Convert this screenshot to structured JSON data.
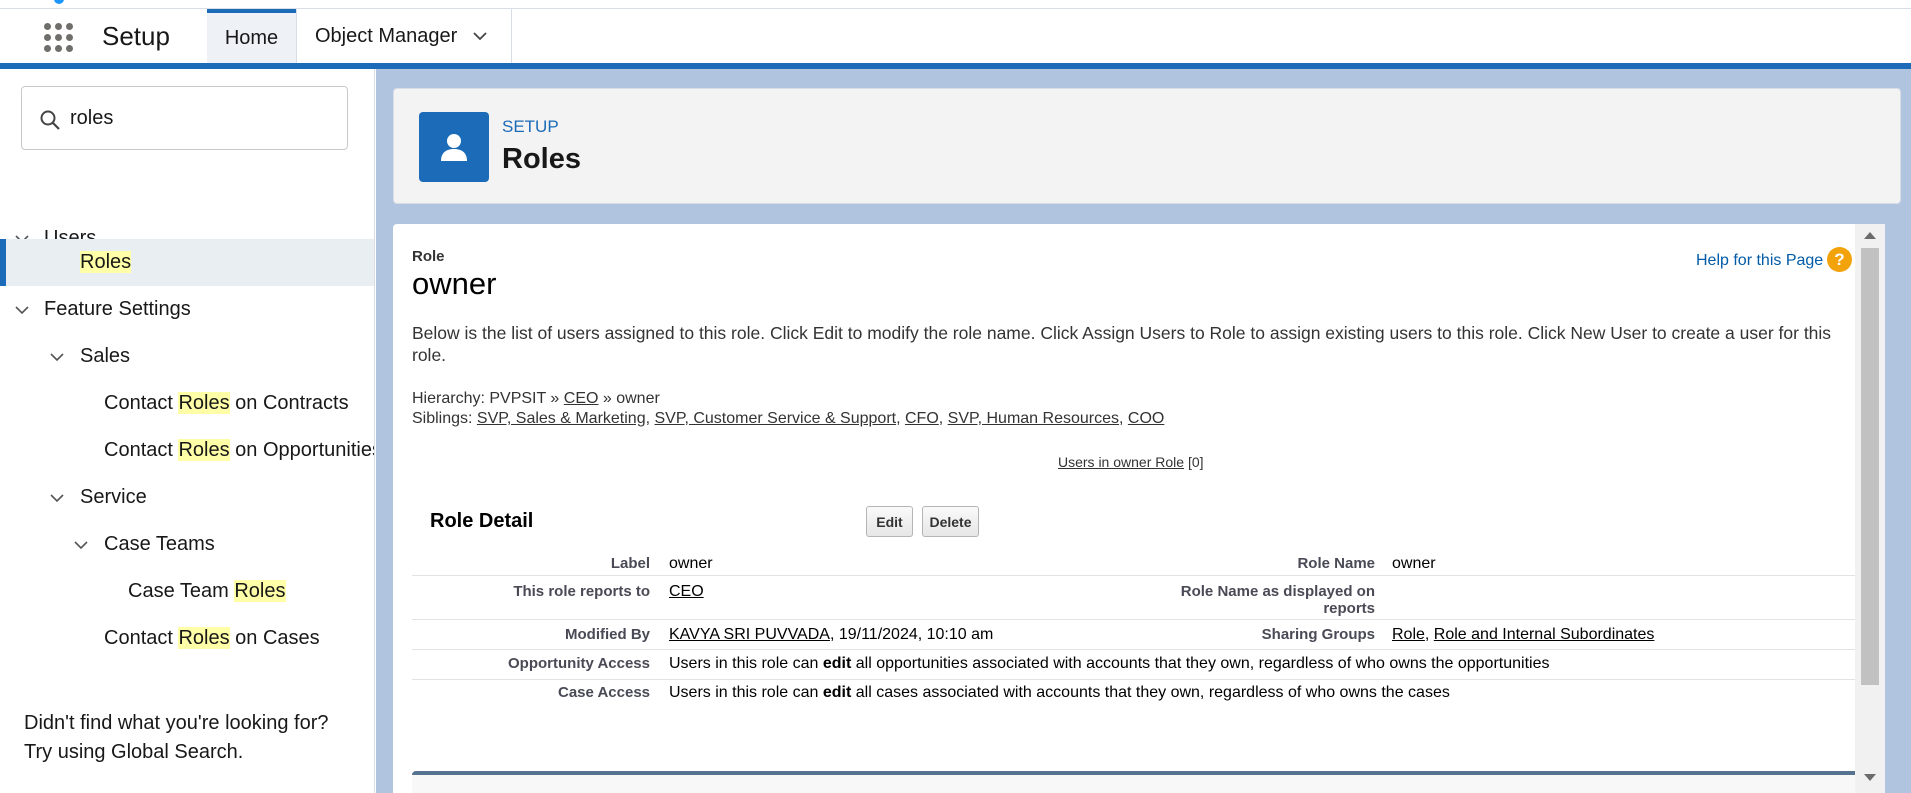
{
  "header": {
    "app_name": "Setup",
    "tabs": [
      {
        "label": "Home"
      },
      {
        "label": "Object Manager"
      }
    ]
  },
  "sidebar": {
    "search_value": "roles",
    "items": [
      {
        "label": "Users"
      },
      {
        "pre": "",
        "hl": "Roles",
        "post": ""
      },
      {
        "label": "Feature Settings"
      },
      {
        "label": "Sales"
      },
      {
        "pre": "Contact ",
        "hl": "Roles",
        "post": " on Contracts"
      },
      {
        "pre": "Contact ",
        "hl": "Roles",
        "post": " on Opportunities"
      },
      {
        "label": "Service"
      },
      {
        "label": "Case Teams"
      },
      {
        "pre": "Case Team ",
        "hl": "Roles",
        "post": ""
      },
      {
        "pre": "Contact ",
        "hl": "Roles",
        "post": " on Cases"
      }
    ],
    "not_found_line1": "Didn't find what you're looking for?",
    "not_found_line2": "Try using Global Search."
  },
  "page_header": {
    "eyebrow": "SETUP",
    "title": "Roles"
  },
  "content": {
    "type_label": "Role",
    "title": "owner",
    "help_link": "Help for this Page",
    "help_icon": "?",
    "description": "Below is the list of users assigned to this role. Click Edit to modify the role name. Click Assign Users to Role to assign existing users to this role. Click New User to create a user for this role.",
    "hierarchy": {
      "prefix": "Hierarchy: PVPSIT » ",
      "link": "CEO",
      "suffix": " » owner"
    },
    "siblings": {
      "prefix": "Siblings: ",
      "links": [
        "SVP, Sales & Marketing",
        "SVP, Customer Service & Support",
        "CFO",
        "SVP, Human Resources",
        "COO"
      ],
      "separator": ", "
    },
    "users_in_role": {
      "link": "Users in owner Role",
      "count": "[0]"
    },
    "role_detail": {
      "title": "Role Detail",
      "edit_label": "Edit",
      "delete_label": "Delete",
      "label_label": "Label",
      "label_value": "owner",
      "role_name_label": "Role Name",
      "role_name_value": "owner",
      "reports_to_label": "This role reports to",
      "reports_to_value": "CEO",
      "display_name_label_1": "Role Name as displayed on",
      "display_name_label_2": "reports",
      "modified_by_label": "Modified By",
      "modified_by_link": "KAVYA SRI PUVVADA",
      "modified_by_date": ", 19/11/2024, 10:10 am",
      "sharing_groups_label": "Sharing Groups",
      "sharing_groups_links": [
        "Role",
        "Role and Internal Subordinates"
      ],
      "opp_access_label": "Opportunity Access",
      "opp_access_pre": "Users in this role can ",
      "opp_access_bold": "edit",
      "opp_access_post": " all opportunities associated with accounts that they own, regardless of who owns the opportunities",
      "case_access_label": "Case Access",
      "case_access_pre": "Users in this role can ",
      "case_access_bold": "edit",
      "case_access_post": " all cases associated with accounts that they own, regardless of who owns the cases"
    }
  },
  "colors": {
    "brand": "#1b6bb8",
    "highlight": "#ffffa8",
    "link": "#015ba7"
  }
}
